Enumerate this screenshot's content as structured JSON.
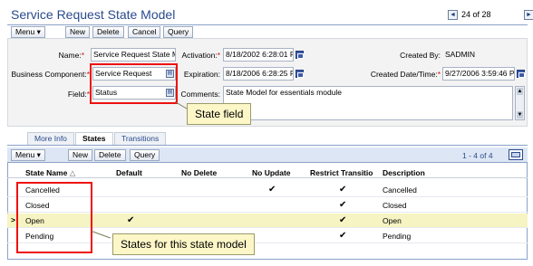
{
  "header": {
    "title": "Service Request State Model",
    "record_count": "24 of 28",
    "prev_icon": "◄",
    "next_icon": "►"
  },
  "toolbar": {
    "menu_label": "Menu ▾",
    "new_label": "New",
    "delete_label": "Delete",
    "cancel_label": "Cancel",
    "query_label": "Query"
  },
  "form": {
    "name_label": "Name:",
    "name_value": "Service Request State M",
    "business_component_label": "Business Component:",
    "business_component_value": "Service Request",
    "field_label": "Field:",
    "field_value": "Status",
    "activation_label": "Activation:",
    "activation_value": "8/18/2002 6:28:01 P",
    "expiration_label": "Expiration:",
    "expiration_value": "8/18/2006 6:28:25 P",
    "comments_label": "Comments:",
    "comments_value": "State Model for essentials module",
    "created_by_label": "Created By:",
    "created_by_value": "SADMIN",
    "created_datetime_label": "Created Date/Time:",
    "created_datetime_value": "9/27/2006 3:59:46 P",
    "required_marker": "*"
  },
  "callouts": {
    "state_field": "State field",
    "states_for_model": "States for this state model"
  },
  "tabs": [
    {
      "label": "More Info",
      "active": false
    },
    {
      "label": "States",
      "active": true
    },
    {
      "label": "Transitions",
      "active": false
    }
  ],
  "list": {
    "toolbar": {
      "menu_label": "Menu ▾",
      "new_label": "New",
      "delete_label": "Delete",
      "query_label": "Query",
      "range": "1 - 4 of 4"
    },
    "columns": {
      "state_name": "State Name",
      "sort_indicator": "△",
      "default": "Default",
      "no_delete": "No Delete",
      "no_update": "No Update",
      "restrict": "Restrict Transitio",
      "description": "Description"
    },
    "rows": [
      {
        "state": "Cancelled",
        "default": "",
        "no_delete": "",
        "no_update": "✔",
        "restrict": "✔",
        "description": "Cancelled"
      },
      {
        "state": "Closed",
        "default": "",
        "no_delete": "",
        "no_update": "",
        "restrict": "✔",
        "description": "Closed"
      },
      {
        "state": "Open",
        "default": "✔",
        "no_delete": "",
        "no_update": "",
        "restrict": "✔",
        "description": "Open"
      },
      {
        "state": "Pending",
        "default": "",
        "no_delete": "",
        "no_update": "",
        "restrict": "✔",
        "description": "Pending"
      }
    ],
    "selected_row_marker": ">"
  }
}
